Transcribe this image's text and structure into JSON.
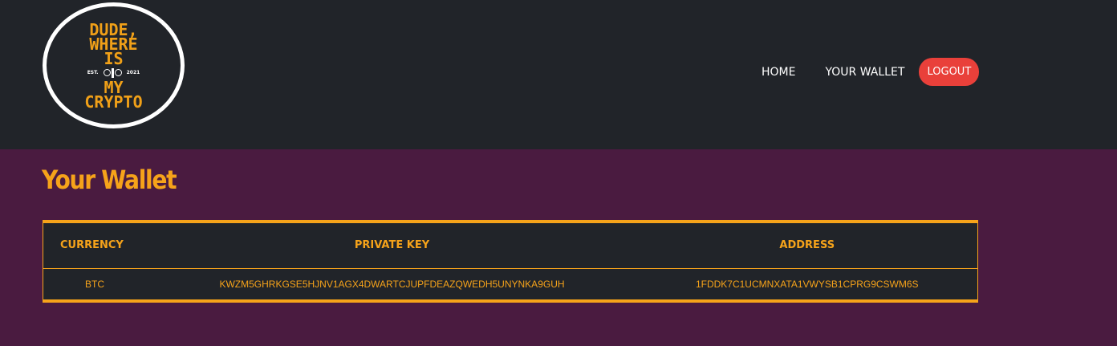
{
  "header": {
    "logo": {
      "line1": "DUDE,",
      "line2": "WHERE",
      "line3": "IS",
      "est_left": "EST.",
      "est_right": "2021",
      "line4": "MY",
      "line5": "CRYPTO"
    },
    "nav": {
      "home": "HOME",
      "your_wallet": "YOUR WALLET",
      "logout": "LOGOUT"
    }
  },
  "main": {
    "title": "Your Wallet",
    "table": {
      "headers": [
        "CURRENCY",
        "PRIVATE KEY",
        "ADDRESS"
      ],
      "rows": [
        {
          "currency": "BTC",
          "private_key": "KWZM5GHRKGSE5HJNV1AGX4DWARTCJUPFDEAZQWEDH5UNYNKA9GUH",
          "address": "1FDDK7C1UCMNXATA1VWYSB1CPRG9CSWM6S"
        }
      ]
    }
  },
  "colors": {
    "header_bg": "#212429",
    "page_bg": "#4a1b40",
    "accent": "#f6a31a",
    "logout_bg": "#e9403a"
  }
}
